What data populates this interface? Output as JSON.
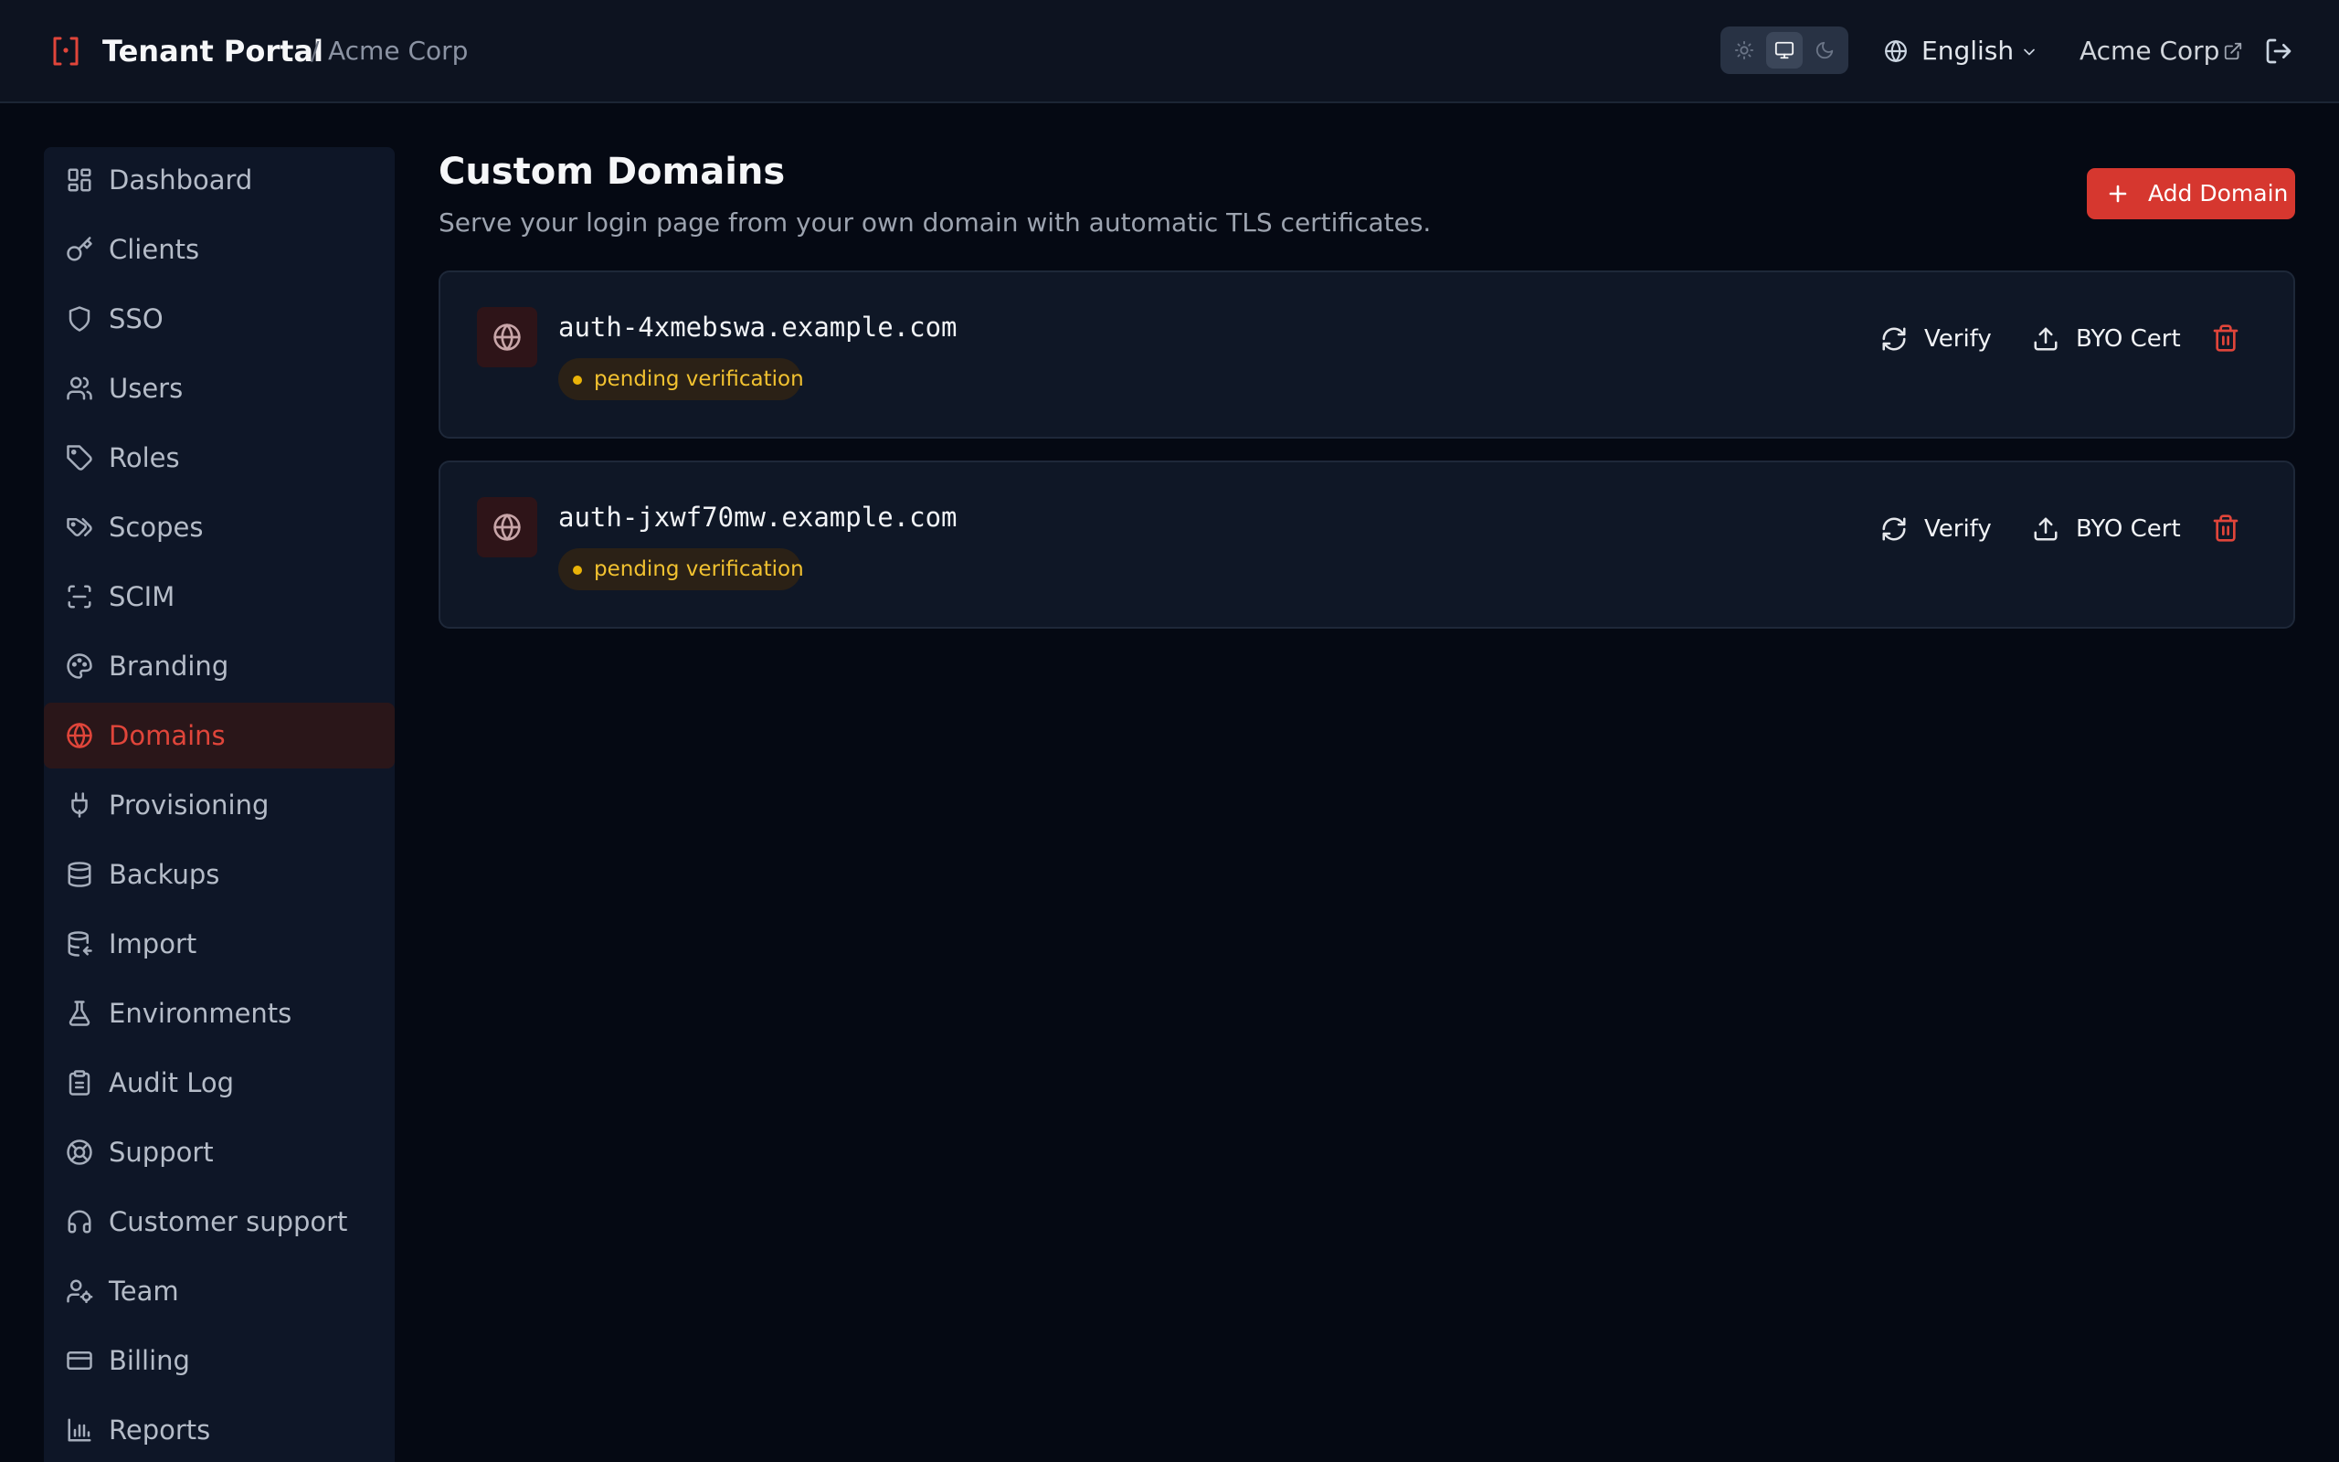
{
  "header": {
    "app_title": "Tenant Portal",
    "breadcrumb_separator": "/",
    "breadcrumb_tenant": "Acme Corp",
    "theme_options": [
      "light",
      "system",
      "dark"
    ],
    "theme_selected": "system",
    "language": "English",
    "org_link": "Acme Corp",
    "icons": [
      "logo-icon",
      "sun-icon",
      "monitor-icon",
      "moon-icon",
      "globe-icon",
      "chevron-down-icon",
      "external-link-icon",
      "logout-icon"
    ]
  },
  "sidebar": {
    "items": [
      {
        "label": "Dashboard",
        "icon": "dashboard-icon"
      },
      {
        "label": "Clients",
        "icon": "key-icon"
      },
      {
        "label": "SSO",
        "icon": "shield-icon"
      },
      {
        "label": "Users",
        "icon": "users-icon"
      },
      {
        "label": "Roles",
        "icon": "tag-icon"
      },
      {
        "label": "Scopes",
        "icon": "tags-icon"
      },
      {
        "label": "SCIM",
        "icon": "scan-icon"
      },
      {
        "label": "Branding",
        "icon": "palette-icon"
      },
      {
        "label": "Domains",
        "icon": "globe-icon",
        "active": true
      },
      {
        "label": "Provisioning",
        "icon": "plug-icon"
      },
      {
        "label": "Backups",
        "icon": "database-icon"
      },
      {
        "label": "Import",
        "icon": "database-import-icon"
      },
      {
        "label": "Environments",
        "icon": "flask-icon"
      },
      {
        "label": "Audit Log",
        "icon": "clipboard-icon"
      },
      {
        "label": "Support",
        "icon": "life-buoy-icon"
      },
      {
        "label": "Customer support",
        "icon": "headset-icon"
      },
      {
        "label": "Team",
        "icon": "user-cog-icon"
      },
      {
        "label": "Billing",
        "icon": "credit-card-icon"
      },
      {
        "label": "Reports",
        "icon": "bar-chart-icon"
      }
    ]
  },
  "main": {
    "title": "Custom Domains",
    "subtitle": "Serve your login page from your own domain with automatic TLS certificates.",
    "add_button": "Add Domain",
    "domains": [
      {
        "name": "auth-4xmebswa.example.com",
        "status": "pending verification",
        "verify_label": "Verify",
        "byo_label": "BYO Cert"
      },
      {
        "name": "auth-jxwf70mw.example.com",
        "status": "pending verification",
        "verify_label": "Verify",
        "byo_label": "BYO Cert"
      }
    ]
  },
  "colors": {
    "accent": "#e0453a",
    "button_bg": "#d6372f",
    "background": "#050913",
    "panel": "#0e1627",
    "status_pending": "#eab308"
  }
}
